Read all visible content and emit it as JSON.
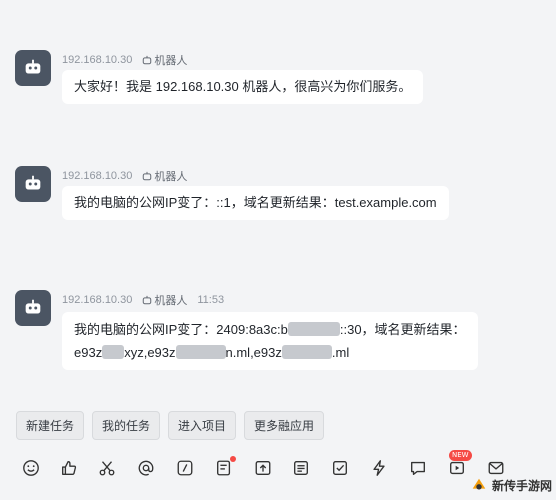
{
  "messages": [
    {
      "sender": "192.168.10.30",
      "tag": "机器人",
      "time": "",
      "lines": [
        "大家好！我是 192.168.10.30 机器人，很高兴为你们服务。"
      ]
    },
    {
      "sender": "192.168.10.30",
      "tag": "机器人",
      "time": "",
      "lines": [
        "我的电脑的公网IP变了：::1，域名更新结果：test.example.com"
      ]
    },
    {
      "sender": "192.168.10.30",
      "tag": "机器人",
      "time": "11:53",
      "line1_a": "我的电脑的公网IP变了：2409:8a3c:b",
      "line1_b": "::30，域名更新结果：",
      "line2_a": "e93z",
      "line2_b": "xyz,e93z",
      "line2_c": "n.ml,e93z",
      "line2_d": ".ml"
    }
  ],
  "quick_actions": [
    "新建任务",
    "我的任务",
    "进入项目",
    "更多融应用"
  ],
  "toolbar_icons": [
    "emoji-icon",
    "thumbs-up-icon",
    "scissors-icon",
    "mention-icon",
    "slash-command-icon",
    "task-icon",
    "upload-icon",
    "document-icon",
    "checkbox-icon",
    "lightning-icon",
    "chat-icon",
    "video-icon",
    "mail-icon"
  ],
  "new_badge": "NEW",
  "watermark": "新传手游网",
  "colors": {
    "avatar": "#4b5563",
    "background": "#f3f4f6",
    "badge": "#f54a45"
  }
}
